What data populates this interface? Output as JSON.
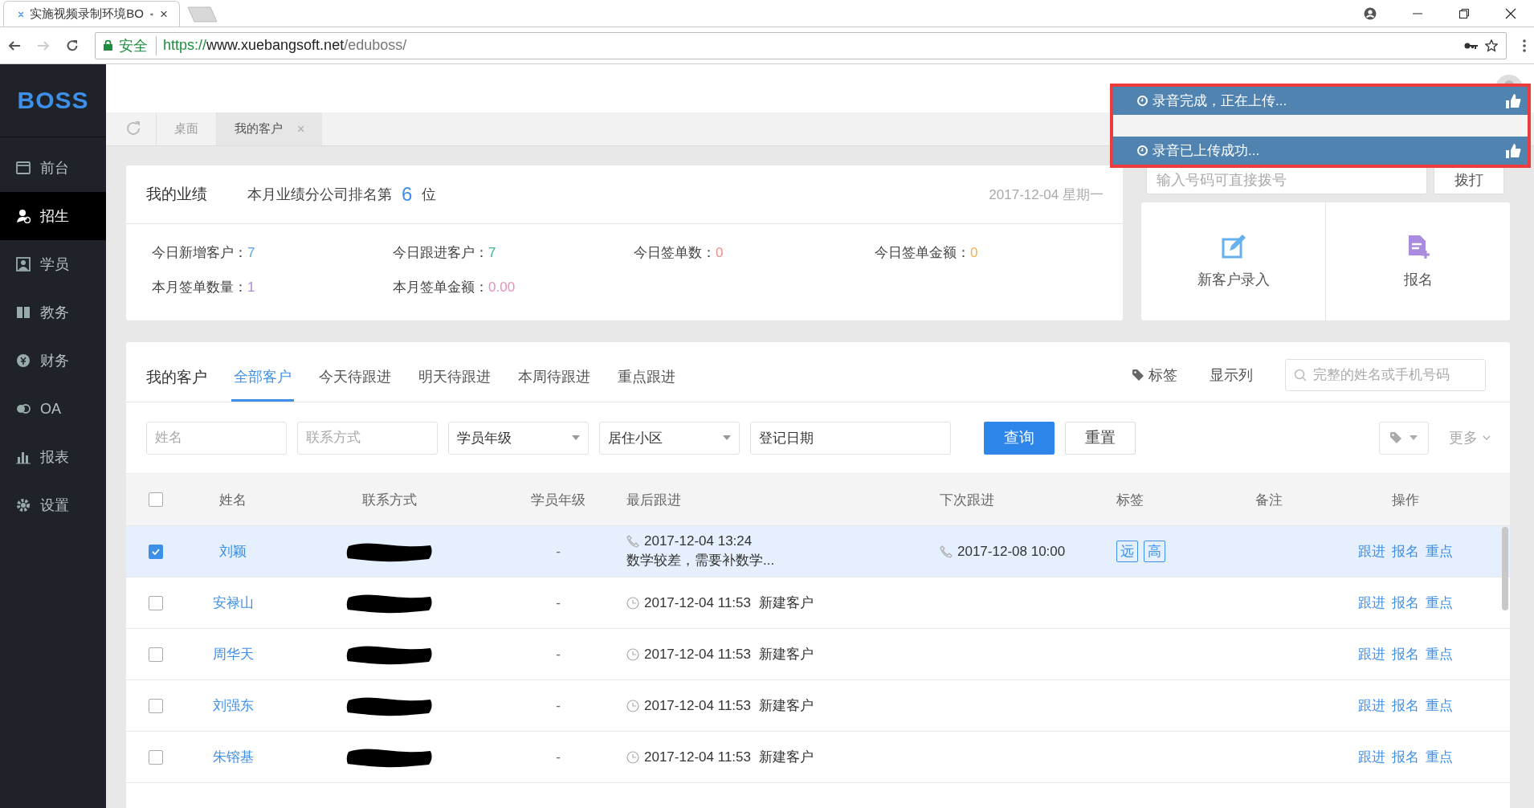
{
  "browser": {
    "tab_title": "实施视频录制环境BO",
    "tab_close": "×",
    "security": "安全",
    "url_scheme": "https://",
    "url_host": "www.xuebangsoft.net",
    "url_path": "/eduboss/"
  },
  "sidebar": {
    "logo": "BOSS",
    "items": [
      {
        "label": "前台",
        "selected": false
      },
      {
        "label": "招生",
        "selected": true
      },
      {
        "label": "学员",
        "selected": false
      },
      {
        "label": "教务",
        "selected": false
      },
      {
        "label": "财务",
        "selected": false
      },
      {
        "label": "OA",
        "selected": false
      },
      {
        "label": "报表",
        "selected": false
      },
      {
        "label": "设置",
        "selected": false
      }
    ]
  },
  "page_tabs": [
    {
      "label": "桌面",
      "selected": false
    },
    {
      "label": "我的客户",
      "selected": true,
      "close": "×"
    }
  ],
  "notifications": [
    {
      "text": "录音完成，正在上传..."
    },
    {
      "text": "录音已上传成功..."
    }
  ],
  "performance": {
    "title": "我的业绩",
    "rank_prefix": "本月业绩分公司排名第",
    "rank": "6",
    "rank_suffix": "位",
    "date": "2017-12-04 星期一",
    "stats": [
      {
        "label": "今日新增客户：",
        "value": "7",
        "color": "#5aa5e6"
      },
      {
        "label": "今日跟进客户：",
        "value": "7",
        "color": "#3cb39b"
      },
      {
        "label": "今日签单数：",
        "value": "0",
        "color": "#f08c8c"
      },
      {
        "label": "今日签单金额：",
        "value": "0",
        "color": "#f5b04c"
      },
      {
        "label": "本月签单数量：",
        "value": "1",
        "color": "#a98bd8"
      },
      {
        "label": "本月签单金额：",
        "value": "0.00",
        "color": "#e88fc0"
      }
    ]
  },
  "dialer": {
    "placeholder": "输入号码可直接拨号",
    "button": "拨打"
  },
  "quick_actions": [
    {
      "label": "新客户录入"
    },
    {
      "label": "报名"
    }
  ],
  "customers": {
    "title": "我的客户",
    "tabs": [
      {
        "label": "全部客户",
        "selected": true
      },
      {
        "label": "今天待跟进",
        "selected": false
      },
      {
        "label": "明天待跟进",
        "selected": false
      },
      {
        "label": "本周待跟进",
        "selected": false
      },
      {
        "label": "重点跟进",
        "selected": false
      }
    ],
    "tag_tool": "标签",
    "columns_tool": "显示列",
    "search_placeholder": "完整的姓名或手机号码",
    "filters": [
      {
        "kind": "input",
        "placeholder": "姓名"
      },
      {
        "kind": "input",
        "placeholder": "联系方式"
      },
      {
        "kind": "select",
        "value": "学员年级"
      },
      {
        "kind": "select",
        "value": "居住小区"
      },
      {
        "kind": "input",
        "value": "登记日期"
      }
    ],
    "query_button": "查询",
    "reset_button": "重置",
    "more": "更多"
  },
  "table": {
    "all_checked": false,
    "columns": [
      "姓名",
      "联系方式",
      "学员年级",
      "最后跟进",
      "下次跟进",
      "标签",
      "备注",
      "操作"
    ],
    "rows": [
      {
        "selected": true,
        "name": "刘颖",
        "grade": "-",
        "last": {
          "kind": "call",
          "time": "2017-12-04 13:24",
          "note": "数学较差，需要补数学..."
        },
        "next": "2017-12-08 10:00",
        "tags": [
          "远",
          "高"
        ],
        "actions": [
          "跟进",
          "报名",
          "重点"
        ]
      },
      {
        "selected": false,
        "name": "安禄山",
        "grade": "-",
        "last": {
          "kind": "clock",
          "time": "2017-12-04 11:53",
          "note": "新建客户"
        },
        "actions": [
          "跟进",
          "报名",
          "重点"
        ]
      },
      {
        "selected": false,
        "name": "周华天",
        "grade": "-",
        "last": {
          "kind": "clock",
          "time": "2017-12-04 11:53",
          "note": "新建客户"
        },
        "actions": [
          "跟进",
          "报名",
          "重点"
        ]
      },
      {
        "selected": false,
        "name": "刘强东",
        "grade": "-",
        "last": {
          "kind": "clock",
          "time": "2017-12-04 11:53",
          "note": "新建客户"
        },
        "actions": [
          "跟进",
          "报名",
          "重点"
        ]
      },
      {
        "selected": false,
        "name": "朱镕基",
        "grade": "-",
        "last": {
          "kind": "clock",
          "time": "2017-12-04 11:53",
          "note": "新建客户"
        },
        "actions": [
          "跟进",
          "报名",
          "重点"
        ]
      }
    ]
  }
}
